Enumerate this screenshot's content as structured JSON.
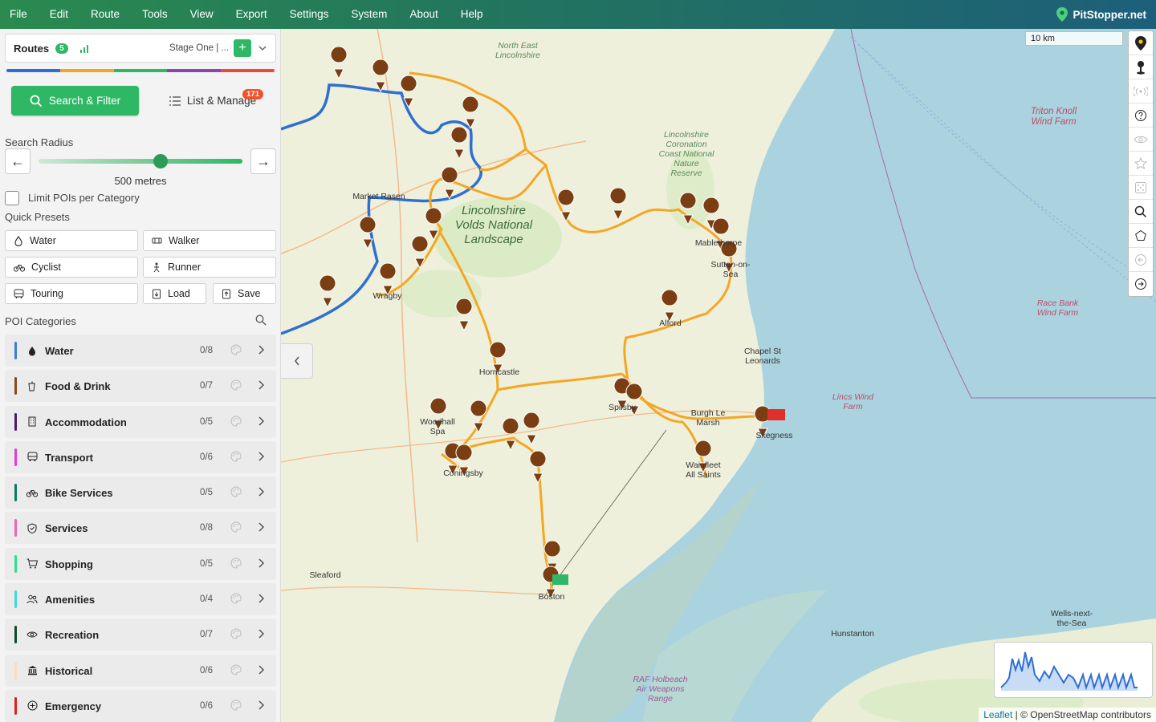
{
  "menu": [
    "File",
    "Edit",
    "Route",
    "Tools",
    "View",
    "Export",
    "Settings",
    "System",
    "About",
    "Help"
  ],
  "brand": "PitStopper.net",
  "routes": {
    "title": "Routes",
    "count": "5",
    "stage": "Stage One | ...",
    "add": "+"
  },
  "actions": {
    "search": "Search & Filter",
    "list": "List & Manage",
    "list_badge": "171"
  },
  "search_radius": {
    "label": "Search Radius",
    "value": "500 metres",
    "prev": "←",
    "next": "→",
    "level": 0.6
  },
  "limit_label": "Limit POIs per Category",
  "presets_label": "Quick Presets",
  "presets": [
    {
      "label": "Water",
      "icon": "drop-icon"
    },
    {
      "label": "Walker",
      "icon": "walker-icon"
    },
    {
      "label": "Cyclist",
      "icon": "bike-icon"
    },
    {
      "label": "Runner",
      "icon": "runner-icon"
    },
    {
      "label": "Touring",
      "icon": "bus-icon"
    },
    {
      "label": "Load",
      "icon": "load-icon"
    },
    {
      "label": "Save",
      "icon": "save-icon"
    }
  ],
  "poi_label": "POI Categories",
  "categories": [
    {
      "name": "Water",
      "count": "0/8",
      "color": "#3b7dd8",
      "icon": "drop-icon"
    },
    {
      "name": "Food & Drink",
      "count": "0/7",
      "color": "#8b4a1e",
      "icon": "cup-icon"
    },
    {
      "name": "Accommodation",
      "count": "0/5",
      "color": "#4b1a6e",
      "icon": "building-icon"
    },
    {
      "name": "Transport",
      "count": "0/6",
      "color": "#e43bd6",
      "icon": "bus-icon"
    },
    {
      "name": "Bike Services",
      "count": "0/5",
      "color": "#0b7a64",
      "icon": "bike-icon"
    },
    {
      "name": "Services",
      "count": "0/8",
      "color": "#f064b0",
      "icon": "shield-icon"
    },
    {
      "name": "Shopping",
      "count": "0/5",
      "color": "#2ee08a",
      "icon": "cart-icon"
    },
    {
      "name": "Amenities",
      "count": "0/4",
      "color": "#38dbe0",
      "icon": "people-icon"
    },
    {
      "name": "Recreation",
      "count": "0/7",
      "color": "#0f4a2a",
      "icon": "eye-icon"
    },
    {
      "name": "Historical",
      "count": "0/6",
      "color": "#f7dcc0",
      "icon": "museum-icon"
    },
    {
      "name": "Emergency",
      "count": "0/6",
      "color": "#e02020",
      "icon": "plus-circle-icon"
    }
  ],
  "map": {
    "scale": "10 km",
    "attribution_leaflet": "Leaflet",
    "attribution_rest": " | © OpenStreetMap contributors",
    "labels": {
      "north_east": "North East\nLincolnshire",
      "coronation": "Lincolnshire\nCoronation\nCoast National\nNature\nReserve",
      "wolds": "Lincolnshire\nVolds National\nLandscape",
      "market_rasen": "Market Rasen",
      "mablethorpe": "Mablethorpe",
      "sutton": "Sutton-on-\nSea",
      "alford": "Alford",
      "chapel": "Chapel St\nLeonards",
      "wragby": "Wragby",
      "horncastle": "Horncastle",
      "spilsby": "Spilsby",
      "burgh": "Burgh Le\nMarsh",
      "skegness": "Skegness",
      "wainfleet": "Wainfleet\nAll Saints",
      "woodhall": "Woodhall\nSpa",
      "coningsby": "Coningsby",
      "sleaford": "Sleaford",
      "boston": "Boston",
      "hunstanton": "Hunstanton",
      "wells": "Wells-next-\nthe-Sea",
      "raf": "RAF Holbeach\nAir Weapons\nRange",
      "triton": "Triton Knoll\nWind Farm",
      "race_bank": "Race Bank\nWind Farm",
      "lincs_wind": "Lincs Wind\nFarm"
    }
  },
  "colors": {
    "accent": "#2eb865",
    "route_orange": "#f5a623",
    "route_blue": "#2f6fd1",
    "poi": "#7a3e12",
    "strip": [
      "#2f6fd1",
      "#f5a623",
      "#2eb865",
      "#8e44ad",
      "#e74c3c"
    ]
  }
}
